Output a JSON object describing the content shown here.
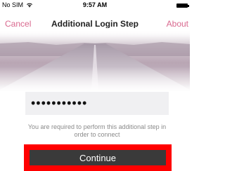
{
  "status_bar": {
    "carrier": "No SIM",
    "wifi_icon": "wifi-icon",
    "time": "9:57 AM",
    "battery_icon": "battery-icon"
  },
  "nav": {
    "cancel_label": "Cancel",
    "title": "Additional Login Step",
    "about_label": "About",
    "link_color": "#d9688e"
  },
  "hero": {
    "image": "road-sky-image"
  },
  "form": {
    "password_value": "•••••••••••",
    "hint": "You are required to perform this additional step in order to connect",
    "continue_label": "Continue",
    "button_color": "#3a3a3a",
    "highlight_color": "#ff0000"
  }
}
